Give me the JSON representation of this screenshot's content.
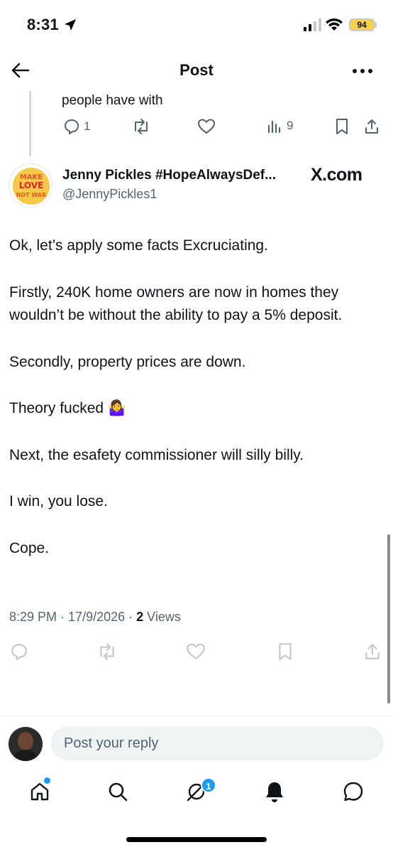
{
  "status_bar": {
    "time": "8:31",
    "battery": "94"
  },
  "header": {
    "title": "Post"
  },
  "previous_post": {
    "text_fragment": "people have with",
    "replies": "1",
    "views": "9"
  },
  "post": {
    "author_name": "Jenny Pickles #HopeAlwaysDef...",
    "author_handle": "@JennyPickles1",
    "source_badge": "X.com",
    "avatar_text": {
      "line1": "MAKE",
      "line2": "LOVE",
      "line3": "NOT WAR"
    },
    "paragraphs": [
      "Ok, let’s apply some facts Excruciating.",
      "Firstly, 240K home owners are now in homes they wouldn’t be without the ability to pay a 5% deposit.",
      "Secondly, property prices are down.",
      "Theory fucked 🤷‍♀️",
      "Next, the esafety commissioner will silly billy.",
      "I win, you lose.",
      "Cope."
    ],
    "time": "8:29 PM",
    "date": "17/9/2026",
    "views_count": "2",
    "views_label": "Views"
  },
  "reply": {
    "placeholder": "Post your reply"
  },
  "tabbar": {
    "messages_badge": "1"
  },
  "colors": {
    "accent": "#1d9bf0",
    "secondary_text": "#536471"
  }
}
